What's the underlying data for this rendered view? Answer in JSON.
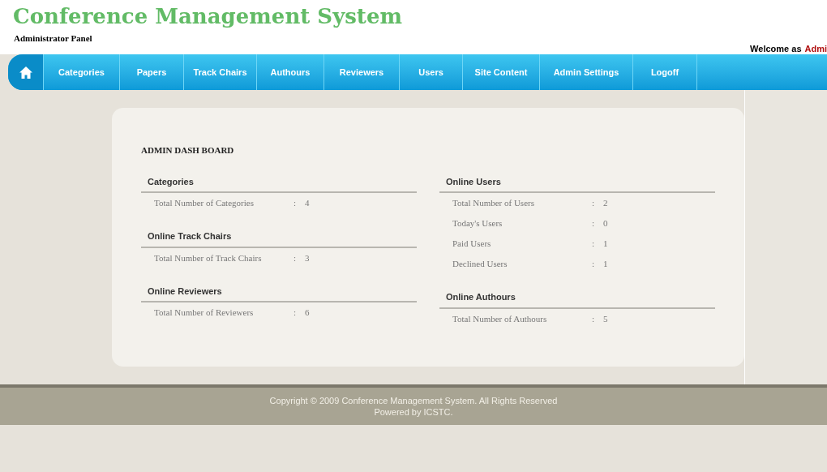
{
  "header": {
    "title": "Conference Management System",
    "subtitle": "Administrator Panel",
    "welcome_label": "Welcome as",
    "welcome_user": "Admi"
  },
  "nav": [
    {
      "kind": "home",
      "selected": true
    },
    {
      "kind": "link",
      "label": "Categories",
      "selected": false
    },
    {
      "kind": "link",
      "label": "Papers",
      "selected": false
    },
    {
      "kind": "link",
      "label": "Track Chairs",
      "selected": false
    },
    {
      "kind": "link",
      "label": "Authours",
      "selected": false
    },
    {
      "kind": "link",
      "label": "Reviewers",
      "selected": false
    },
    {
      "kind": "link",
      "label": "Users",
      "selected": false
    },
    {
      "kind": "link",
      "label": "Site Content",
      "selected": false
    },
    {
      "kind": "link",
      "label": "Admin Settings",
      "selected": false
    },
    {
      "kind": "link",
      "label": "Logoff",
      "selected": false
    }
  ],
  "dashboard": {
    "title": "ADMIN DASH BOARD",
    "columns": [
      [
        {
          "heading": "Categories",
          "rows": [
            {
              "label": "Total Number of Categories",
              "separator": ":",
              "value": "4"
            }
          ]
        },
        {
          "heading": "Online Track Chairs",
          "rows": [
            {
              "label": "Total Number of Track Chairs",
              "separator": ":",
              "value": "3"
            }
          ]
        },
        {
          "heading": "Online Reviewers",
          "rows": [
            {
              "label": "Total Number of Reviewers",
              "separator": ":",
              "value": "6"
            }
          ]
        }
      ],
      [
        {
          "heading": "Online Users",
          "rows": [
            {
              "label": "Total Number of Users",
              "separator": ":",
              "value": "2"
            },
            {
              "label": "Today's Users",
              "separator": ":",
              "value": "0"
            },
            {
              "label": "Paid Users",
              "separator": ":",
              "value": "1"
            },
            {
              "label": "Declined Users",
              "separator": ":",
              "value": "1"
            }
          ]
        },
        {
          "heading": "Online Authours",
          "rows": [
            {
              "label": "Total Number of Authours",
              "separator": ":",
              "value": "5"
            }
          ]
        }
      ]
    ]
  },
  "footer": {
    "copyright": "Copyright © 2009 Conference Management System. All Rights Reserved",
    "powered": "Powered by ICSTC."
  }
}
